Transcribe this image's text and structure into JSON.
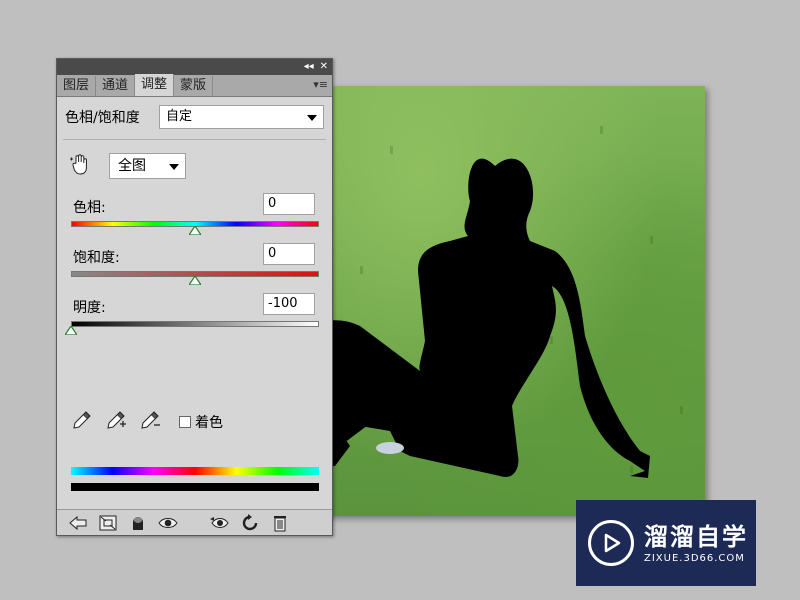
{
  "panel": {
    "tabs": [
      "图层",
      "通道",
      "调整",
      "蒙版"
    ],
    "active_tab": "调整",
    "adjustment_title": "色相/饱和度",
    "preset": {
      "value": "自定"
    },
    "edit_range": {
      "value": "全图"
    },
    "fields": {
      "hue": {
        "label": "色相:",
        "value": "0"
      },
      "saturation": {
        "label": "饱和度:",
        "value": "0"
      },
      "lightness": {
        "label": "明度:",
        "value": "-100"
      }
    },
    "slider_levels": {
      "hue": 0.5,
      "saturation": 0.5,
      "lightness": 0.0
    },
    "colorize": {
      "label": "着色",
      "checked": false
    },
    "toolbar_icons": [
      "back-arrow-icon",
      "expand-view-icon",
      "clip-layer-icon",
      "visibility-eye-icon",
      "view-previous-icon",
      "reset-icon",
      "trash-icon"
    ]
  },
  "watermark": {
    "title": "溜溜自学",
    "subtitle": "ZIXUE.3D66.COM"
  },
  "colors": {
    "panel_bg": "#d6d6d6",
    "tab_bar": "#a9a9a9",
    "workspace": "#bfbfbf",
    "watermark_bg": "#1d2a55"
  }
}
